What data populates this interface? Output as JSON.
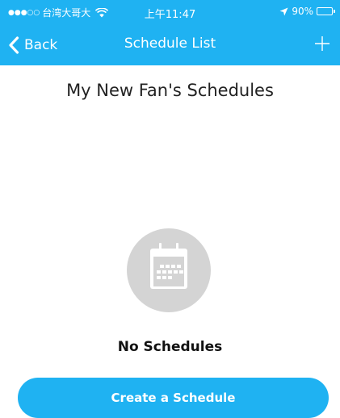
{
  "status_bar": {
    "signal_dots": "●●●○○",
    "carrier": "台湾大哥大",
    "time": "上午11:47",
    "battery": "90%",
    "battery_level": 0.9
  },
  "nav": {
    "back_label": "Back",
    "title": "Schedule List"
  },
  "heading": "My New Fan's Schedules",
  "empty_state": {
    "icon": "calendar-icon",
    "label": "No Schedules"
  },
  "create_button": "Create a Schedule",
  "colors": {
    "accent": "#1fb2f2",
    "icon_circle": "#d4d4d4"
  }
}
